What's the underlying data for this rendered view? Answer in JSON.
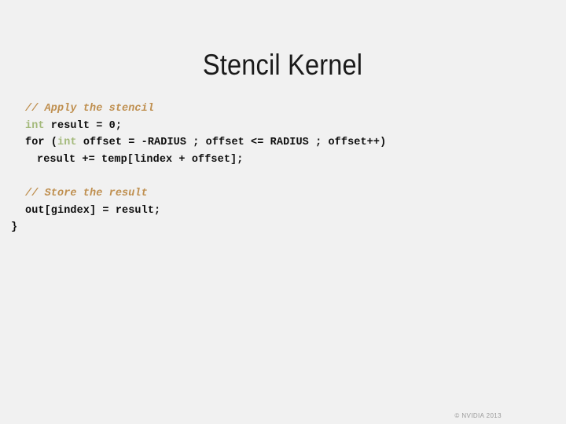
{
  "slide": {
    "title": "Stencil Kernel",
    "background_color": "#f1f1f1",
    "title_color": "#1a1a1a"
  },
  "theme": {
    "comment_color": "#bf8f4f",
    "keyword_color": "#a3b97a",
    "code_color": "#0d0d0d",
    "footer_color": "#9a9a9a"
  },
  "code": {
    "lines": [
      {
        "indent": 1,
        "tokens": [
          {
            "kind": "comment",
            "text": "// Apply the stencil"
          }
        ]
      },
      {
        "indent": 1,
        "tokens": [
          {
            "kind": "keyword",
            "text": "int"
          },
          {
            "kind": "plain",
            "text": " result = 0;"
          }
        ]
      },
      {
        "indent": 1,
        "tokens": [
          {
            "kind": "plain",
            "text": "for ("
          },
          {
            "kind": "keyword",
            "text": "int"
          },
          {
            "kind": "plain",
            "text": " offset = -RADIUS ; offset <= RADIUS ; offset++)"
          }
        ]
      },
      {
        "indent": 2,
        "tokens": [
          {
            "kind": "plain",
            "text": "result += temp[lindex + offset];"
          }
        ]
      },
      {
        "indent": 0,
        "tokens": []
      },
      {
        "indent": 1,
        "tokens": [
          {
            "kind": "comment",
            "text": "// Store the result"
          }
        ]
      },
      {
        "indent": 1,
        "tokens": [
          {
            "kind": "plain",
            "text": "out[gindex] = result;"
          }
        ]
      },
      {
        "indent": 0,
        "tokens": [
          {
            "kind": "plain",
            "text": "}"
          }
        ]
      }
    ]
  },
  "footer": {
    "copyright": "© NVIDIA 2013"
  }
}
